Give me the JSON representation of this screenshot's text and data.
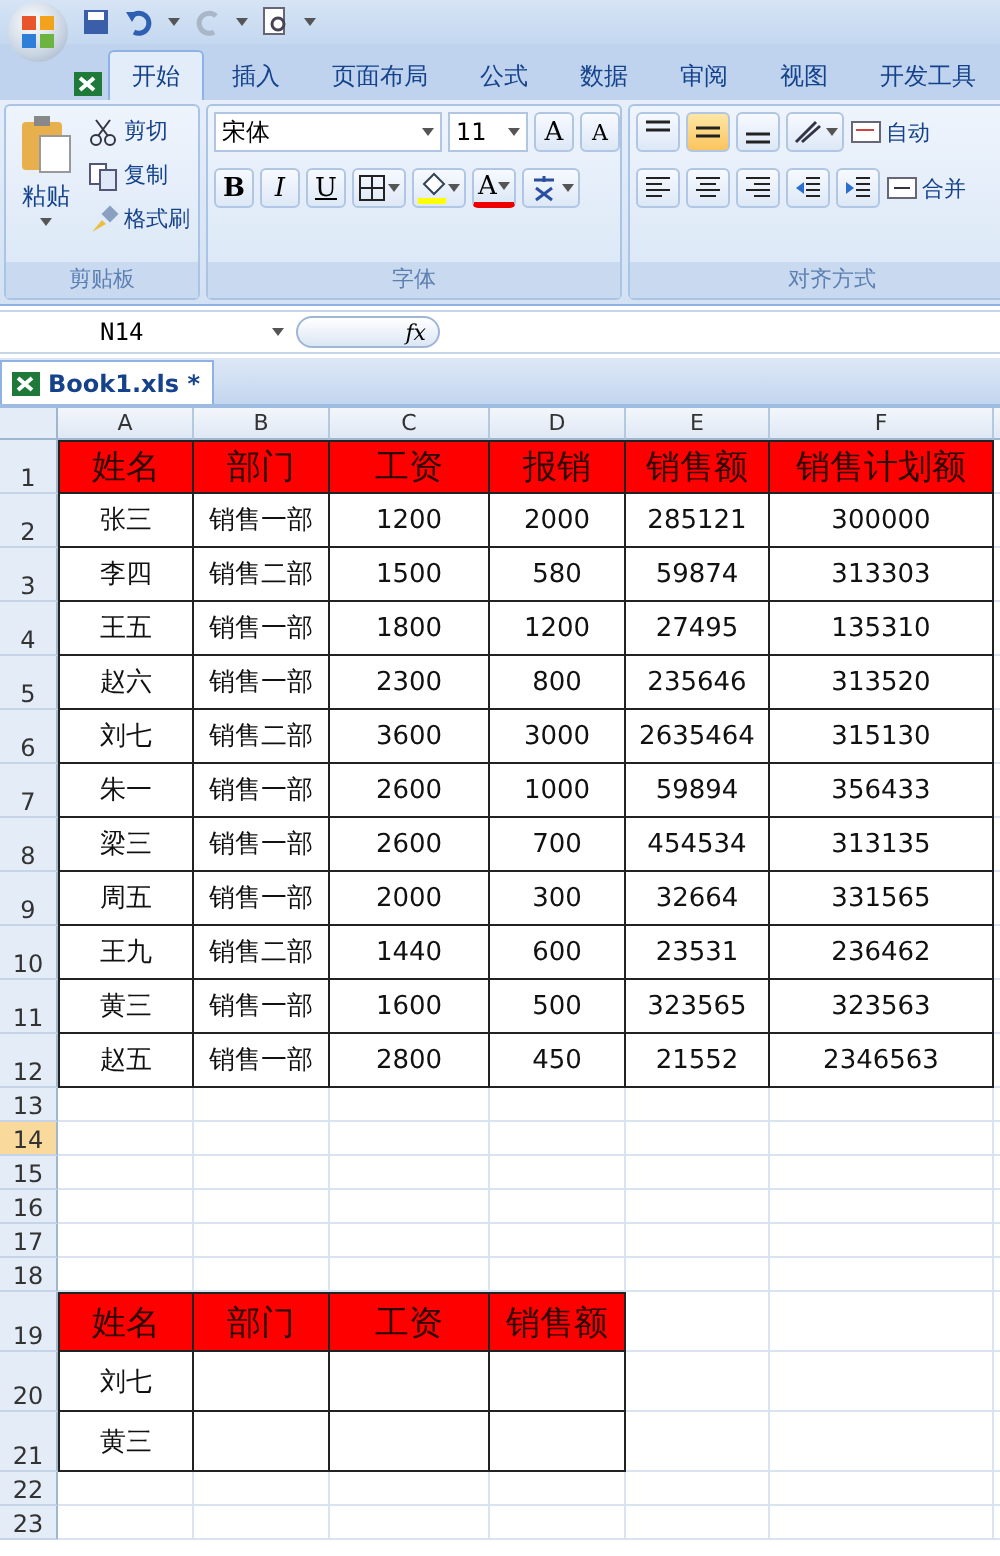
{
  "ribbon_tabs": [
    {
      "label": "开始",
      "selected": true
    },
    {
      "label": "插入",
      "selected": false
    },
    {
      "label": "页面布局",
      "selected": false
    },
    {
      "label": "公式",
      "selected": false
    },
    {
      "label": "数据",
      "selected": false
    },
    {
      "label": "审阅",
      "selected": false
    },
    {
      "label": "视图",
      "selected": false
    },
    {
      "label": "开发工具",
      "selected": false
    }
  ],
  "clipboard": {
    "title": "剪贴板",
    "paste": "粘贴",
    "actions": [
      {
        "kind": "cut",
        "label": "剪切"
      },
      {
        "kind": "copy",
        "label": "复制"
      },
      {
        "kind": "painter",
        "label": "格式刷"
      }
    ]
  },
  "font": {
    "title": "字体",
    "name": "宋体",
    "size": "11",
    "grow": "A",
    "shrink": "A",
    "bold": "B",
    "italic": "I",
    "underline": "U",
    "font_color": "A"
  },
  "alignment": {
    "title": "对齐方式",
    "vertical": [
      {
        "selected": false
      },
      {
        "selected": true
      },
      {
        "selected": false
      }
    ],
    "wrap": "自动",
    "merge": "合并"
  },
  "name_box": "N14",
  "formula_label": "fx",
  "workbook_tab": "Book1.xls *",
  "sheet": {
    "columns": [
      "A",
      "B",
      "C",
      "D",
      "E",
      "F"
    ],
    "rows": [
      {
        "number": "1",
        "selected": false,
        "cells": [
          {
            "kind": "header",
            "text": "姓名"
          },
          {
            "kind": "header",
            "text": "部门"
          },
          {
            "kind": "header",
            "text": "工资"
          },
          {
            "kind": "header",
            "text": "报销"
          },
          {
            "kind": "header",
            "text": "销售额"
          },
          {
            "kind": "header",
            "text": "销售计划额"
          }
        ]
      },
      {
        "number": "2",
        "selected": false,
        "cells": [
          {
            "kind": "data",
            "text": "张三"
          },
          {
            "kind": "data",
            "text": "销售一部"
          },
          {
            "kind": "data",
            "text": "1200"
          },
          {
            "kind": "data",
            "text": "2000"
          },
          {
            "kind": "data",
            "text": "285121"
          },
          {
            "kind": "data",
            "text": "300000"
          }
        ]
      },
      {
        "number": "3",
        "selected": false,
        "cells": [
          {
            "kind": "data",
            "text": "李四"
          },
          {
            "kind": "data",
            "text": "销售二部"
          },
          {
            "kind": "data",
            "text": "1500"
          },
          {
            "kind": "data",
            "text": "580"
          },
          {
            "kind": "data",
            "text": "59874"
          },
          {
            "kind": "data",
            "text": "313303"
          }
        ]
      },
      {
        "number": "4",
        "selected": false,
        "cells": [
          {
            "kind": "data",
            "text": "王五"
          },
          {
            "kind": "data",
            "text": "销售一部"
          },
          {
            "kind": "data",
            "text": "1800"
          },
          {
            "kind": "data",
            "text": "1200"
          },
          {
            "kind": "data",
            "text": "27495"
          },
          {
            "kind": "data",
            "text": "135310"
          }
        ]
      },
      {
        "number": "5",
        "selected": false,
        "cells": [
          {
            "kind": "data",
            "text": "赵六"
          },
          {
            "kind": "data",
            "text": "销售一部"
          },
          {
            "kind": "data",
            "text": "2300"
          },
          {
            "kind": "data",
            "text": "800"
          },
          {
            "kind": "data",
            "text": "235646"
          },
          {
            "kind": "data",
            "text": "313520"
          }
        ]
      },
      {
        "number": "6",
        "selected": false,
        "cells": [
          {
            "kind": "data",
            "text": "刘七"
          },
          {
            "kind": "data",
            "text": "销售二部"
          },
          {
            "kind": "data",
            "text": "3600"
          },
          {
            "kind": "data",
            "text": "3000"
          },
          {
            "kind": "data",
            "text": "2635464"
          },
          {
            "kind": "data",
            "text": "315130"
          }
        ]
      },
      {
        "number": "7",
        "selected": false,
        "cells": [
          {
            "kind": "data",
            "text": "朱一"
          },
          {
            "kind": "data",
            "text": "销售一部"
          },
          {
            "kind": "data",
            "text": "2600"
          },
          {
            "kind": "data",
            "text": "1000"
          },
          {
            "kind": "data",
            "text": "59894"
          },
          {
            "kind": "data",
            "text": "356433"
          }
        ]
      },
      {
        "number": "8",
        "selected": false,
        "cells": [
          {
            "kind": "data",
            "text": "梁三"
          },
          {
            "kind": "data",
            "text": "销售一部"
          },
          {
            "kind": "data",
            "text": "2600"
          },
          {
            "kind": "data",
            "text": "700"
          },
          {
            "kind": "data",
            "text": "454534"
          },
          {
            "kind": "data",
            "text": "313135"
          }
        ]
      },
      {
        "number": "9",
        "selected": false,
        "cells": [
          {
            "kind": "data",
            "text": "周五"
          },
          {
            "kind": "data",
            "text": "销售一部"
          },
          {
            "kind": "data",
            "text": "2000"
          },
          {
            "kind": "data",
            "text": "300"
          },
          {
            "kind": "data",
            "text": "32664"
          },
          {
            "kind": "data",
            "text": "331565"
          }
        ]
      },
      {
        "number": "10",
        "selected": false,
        "cells": [
          {
            "kind": "data",
            "text": "王九"
          },
          {
            "kind": "data",
            "text": "销售二部"
          },
          {
            "kind": "data",
            "text": "1440"
          },
          {
            "kind": "data",
            "text": "600"
          },
          {
            "kind": "data",
            "text": "23531"
          },
          {
            "kind": "data",
            "text": "236462"
          }
        ]
      },
      {
        "number": "11",
        "selected": false,
        "cells": [
          {
            "kind": "data",
            "text": "黄三"
          },
          {
            "kind": "data",
            "text": "销售一部"
          },
          {
            "kind": "data",
            "text": "1600"
          },
          {
            "kind": "data",
            "text": "500"
          },
          {
            "kind": "data",
            "text": "323565"
          },
          {
            "kind": "data",
            "text": "323563"
          }
        ]
      },
      {
        "number": "12",
        "selected": false,
        "cells": [
          {
            "kind": "data",
            "text": "赵五"
          },
          {
            "kind": "data",
            "text": "销售一部"
          },
          {
            "kind": "data",
            "text": "2800"
          },
          {
            "kind": "data",
            "text": "450"
          },
          {
            "kind": "data",
            "text": "21552"
          },
          {
            "kind": "data",
            "text": "2346563"
          }
        ]
      },
      {
        "number": "13",
        "selected": false
      },
      {
        "number": "14",
        "selected": true
      },
      {
        "number": "15",
        "selected": false
      },
      {
        "number": "16",
        "selected": false
      },
      {
        "number": "17",
        "selected": false
      },
      {
        "number": "18",
        "selected": false
      },
      {
        "number": "19",
        "selected": false,
        "cells": [
          {
            "kind": "header",
            "text": "姓名"
          },
          {
            "kind": "header",
            "text": "部门"
          },
          {
            "kind": "header",
            "text": "工资"
          },
          {
            "kind": "header",
            "text": "销售额"
          }
        ]
      },
      {
        "number": "20",
        "selected": false,
        "cells": [
          {
            "kind": "data",
            "text": "刘七"
          },
          {
            "kind": "data"
          },
          {
            "kind": "data"
          },
          {
            "kind": "data"
          }
        ]
      },
      {
        "number": "21",
        "selected": false,
        "cells": [
          {
            "kind": "data",
            "text": "黄三"
          },
          {
            "kind": "data"
          },
          {
            "kind": "data"
          },
          {
            "kind": "data"
          }
        ]
      },
      {
        "number": "22",
        "selected": false
      },
      {
        "number": "23",
        "selected": false
      }
    ]
  }
}
